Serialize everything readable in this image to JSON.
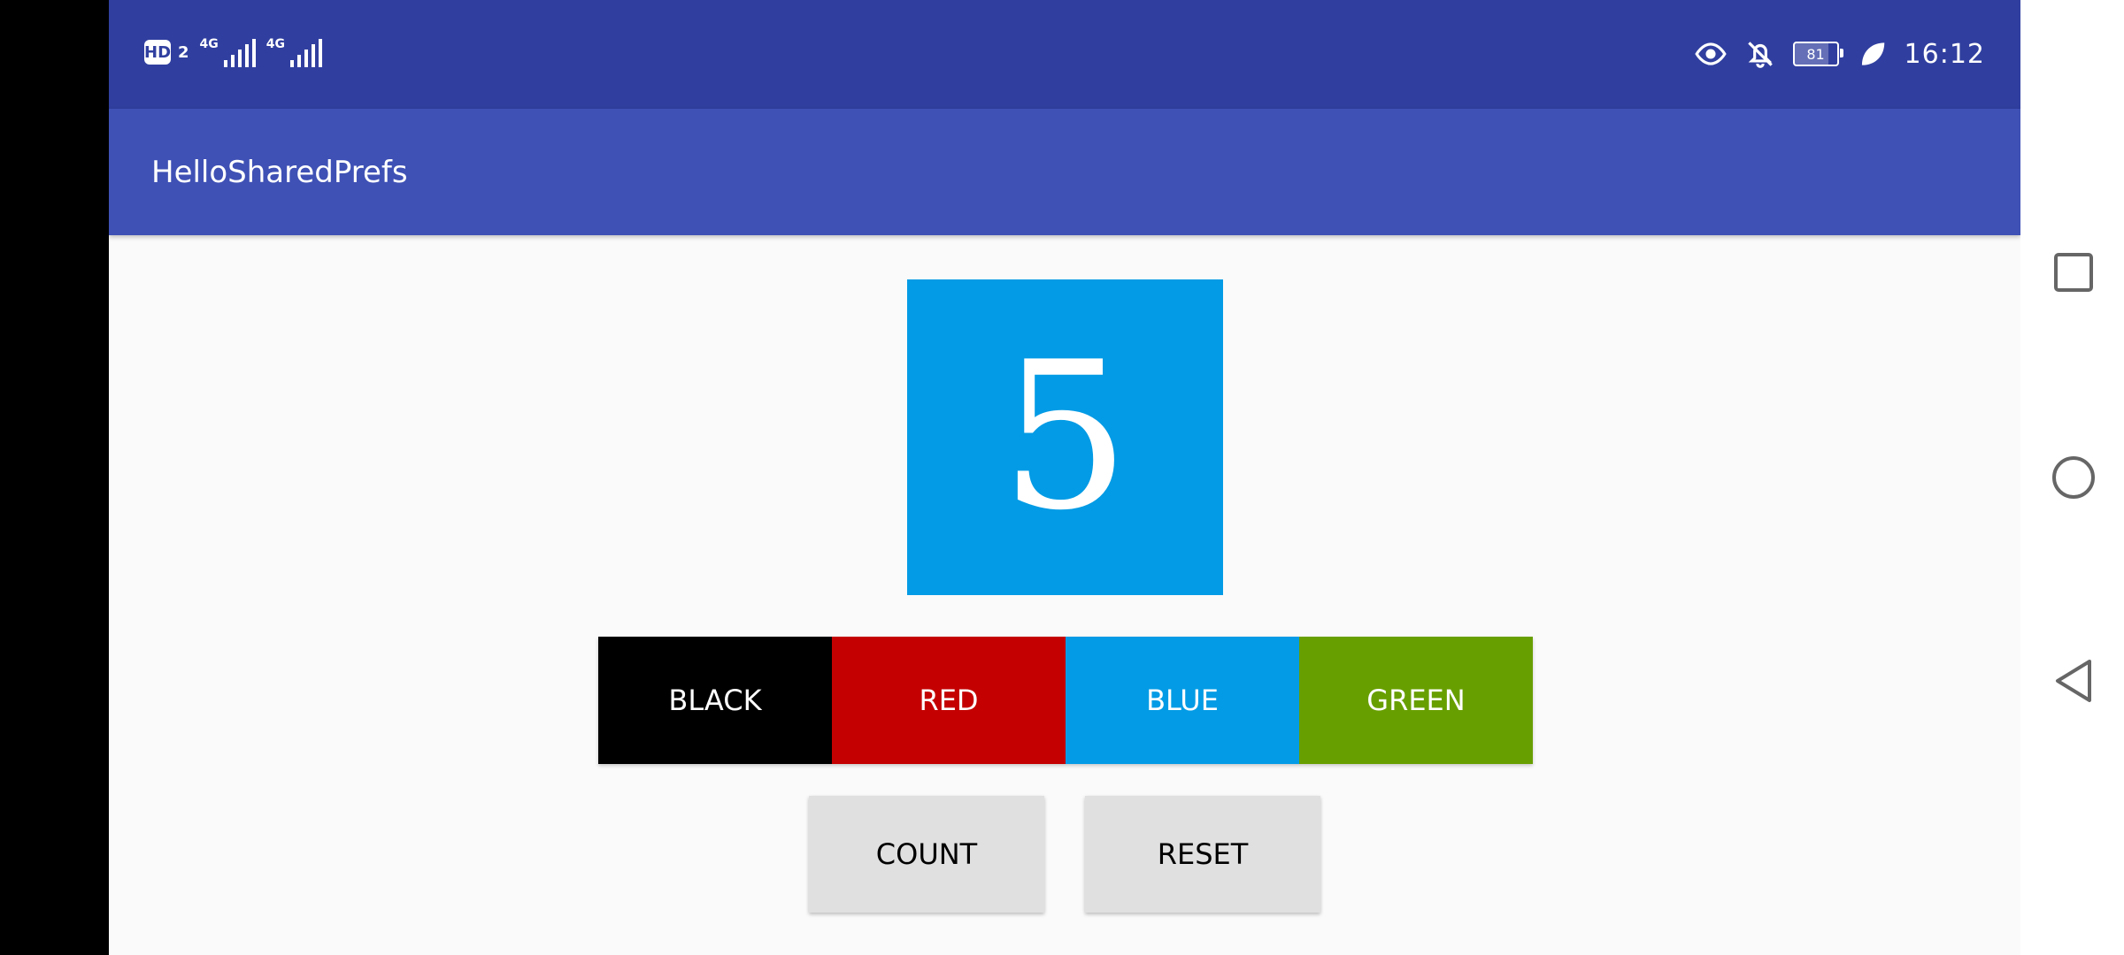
{
  "status_bar": {
    "hd_label": "HD",
    "sim_label": "2",
    "net1_label": "4G",
    "net2_label": "4G",
    "battery_percent": "81",
    "battery_level": 0.81,
    "time": "16:12"
  },
  "app_bar": {
    "title": "HelloSharedPrefs"
  },
  "main": {
    "count_value": "5",
    "count_bg": "#039be5",
    "color_buttons": [
      {
        "label": "BLACK",
        "color": "#000000"
      },
      {
        "label": "RED",
        "color": "#c40000"
      },
      {
        "label": "BLUE",
        "color": "#039be5"
      },
      {
        "label": "GREEN",
        "color": "#689f00"
      }
    ],
    "count_button_label": "COUNT",
    "reset_button_label": "RESET"
  },
  "nav_bar": {
    "icons": [
      "recent-apps-icon",
      "home-icon",
      "back-icon"
    ]
  }
}
